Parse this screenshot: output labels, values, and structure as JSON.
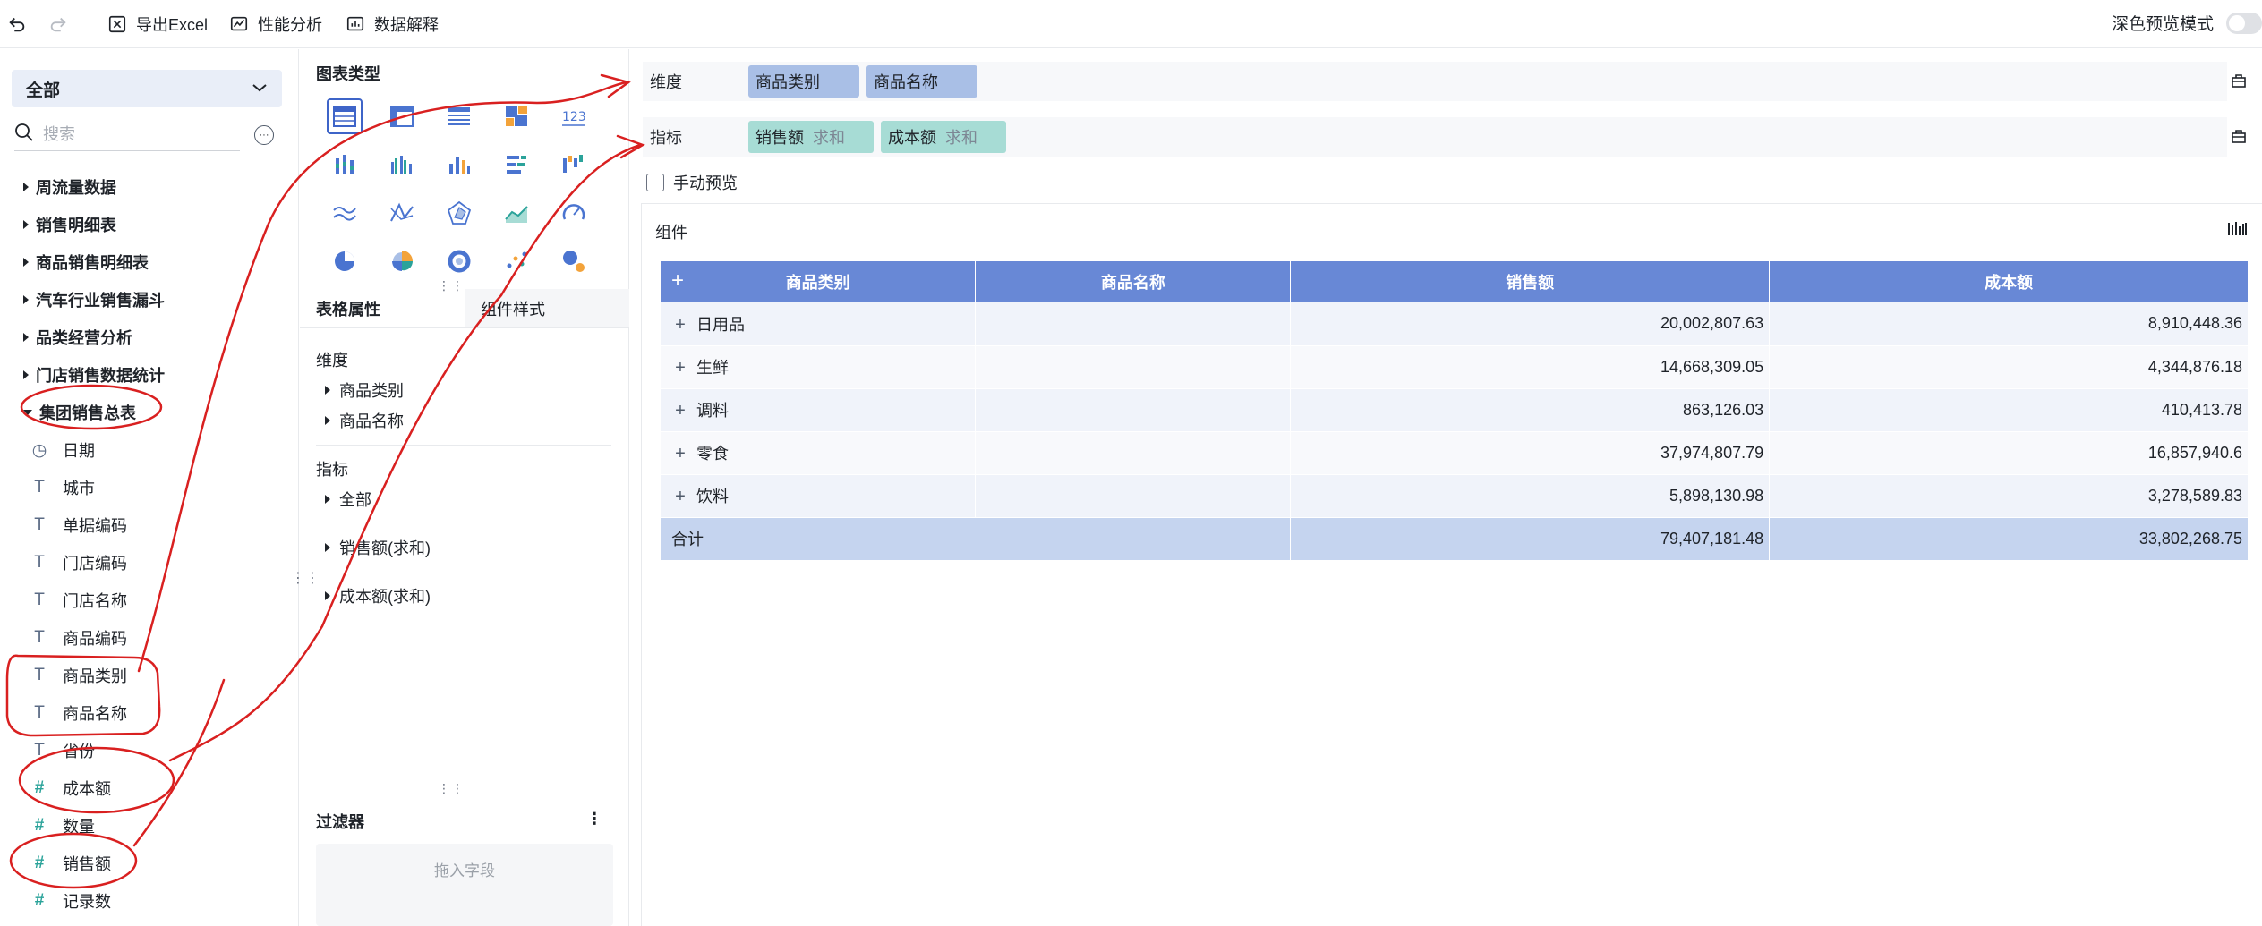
{
  "toolbar": {
    "undo_icon": "undo-icon",
    "redo_icon": "redo-icon",
    "export_label": "导出Excel",
    "perf_label": "性能分析",
    "explain_label": "数据解释",
    "dark_mode_label": "深色预览模式"
  },
  "left": {
    "scope": "全部",
    "search_placeholder": "搜索",
    "folders": [
      "周流量数据",
      "销售明细表",
      "商品销售明细表",
      "汽车行业销售漏斗",
      "品类经营分析",
      "门店销售数据统计"
    ],
    "open_folder": "集团销售总表",
    "fields": [
      {
        "label": "日期",
        "type": "date"
      },
      {
        "label": "城市",
        "type": "text"
      },
      {
        "label": "单据编码",
        "type": "text"
      },
      {
        "label": "门店编码",
        "type": "text"
      },
      {
        "label": "门店名称",
        "type": "text"
      },
      {
        "label": "商品编码",
        "type": "text"
      },
      {
        "label": "商品类别",
        "type": "text"
      },
      {
        "label": "商品名称",
        "type": "text"
      },
      {
        "label": "省份",
        "type": "text"
      },
      {
        "label": "成本额",
        "type": "number"
      },
      {
        "label": "数量",
        "type": "number"
      },
      {
        "label": "销售额",
        "type": "number"
      },
      {
        "label": "记录数",
        "type": "number"
      }
    ]
  },
  "middle": {
    "chart_type_title": "图表类型",
    "tabs": [
      "表格属性",
      "组件样式"
    ],
    "dim_label": "维度",
    "dim_items": [
      "商品类别",
      "商品名称"
    ],
    "metric_label": "指标",
    "metric_items": [
      "全部",
      "销售额(求和)",
      "成本额(求和)"
    ],
    "filter_title": "过滤器",
    "filter_placeholder": "拖入字段"
  },
  "shelves": {
    "dim_label": "维度",
    "dims": [
      "商品类别",
      "商品名称"
    ],
    "metric_label": "指标",
    "metrics": [
      {
        "name": "销售额",
        "agg": "求和"
      },
      {
        "name": "成本额",
        "agg": "求和"
      }
    ],
    "manual_preview": "手动预览"
  },
  "component": {
    "title": "组件",
    "headers": [
      "商品类别",
      "商品名称",
      "销售额",
      "成本额"
    ],
    "rows": [
      {
        "cat": "日用品",
        "sales": "20,002,807.63",
        "cost": "8,910,448.36"
      },
      {
        "cat": "生鲜",
        "sales": "14,668,309.05",
        "cost": "4,344,876.18"
      },
      {
        "cat": "调料",
        "sales": "863,126.03",
        "cost": "410,413.78"
      },
      {
        "cat": "零食",
        "sales": "37,974,807.79",
        "cost": "16,857,940.6"
      },
      {
        "cat": "饮料",
        "sales": "5,898,130.98",
        "cost": "3,278,589.83"
      }
    ],
    "total": {
      "label": "合计",
      "sales": "79,407,181.48",
      "cost": "33,802,268.75"
    }
  },
  "colors": {
    "header_blue": "#6888d6",
    "dim_pill": "#a9bfe6",
    "metric_pill": "#a7dcd5",
    "annotation_red": "#d92020"
  }
}
